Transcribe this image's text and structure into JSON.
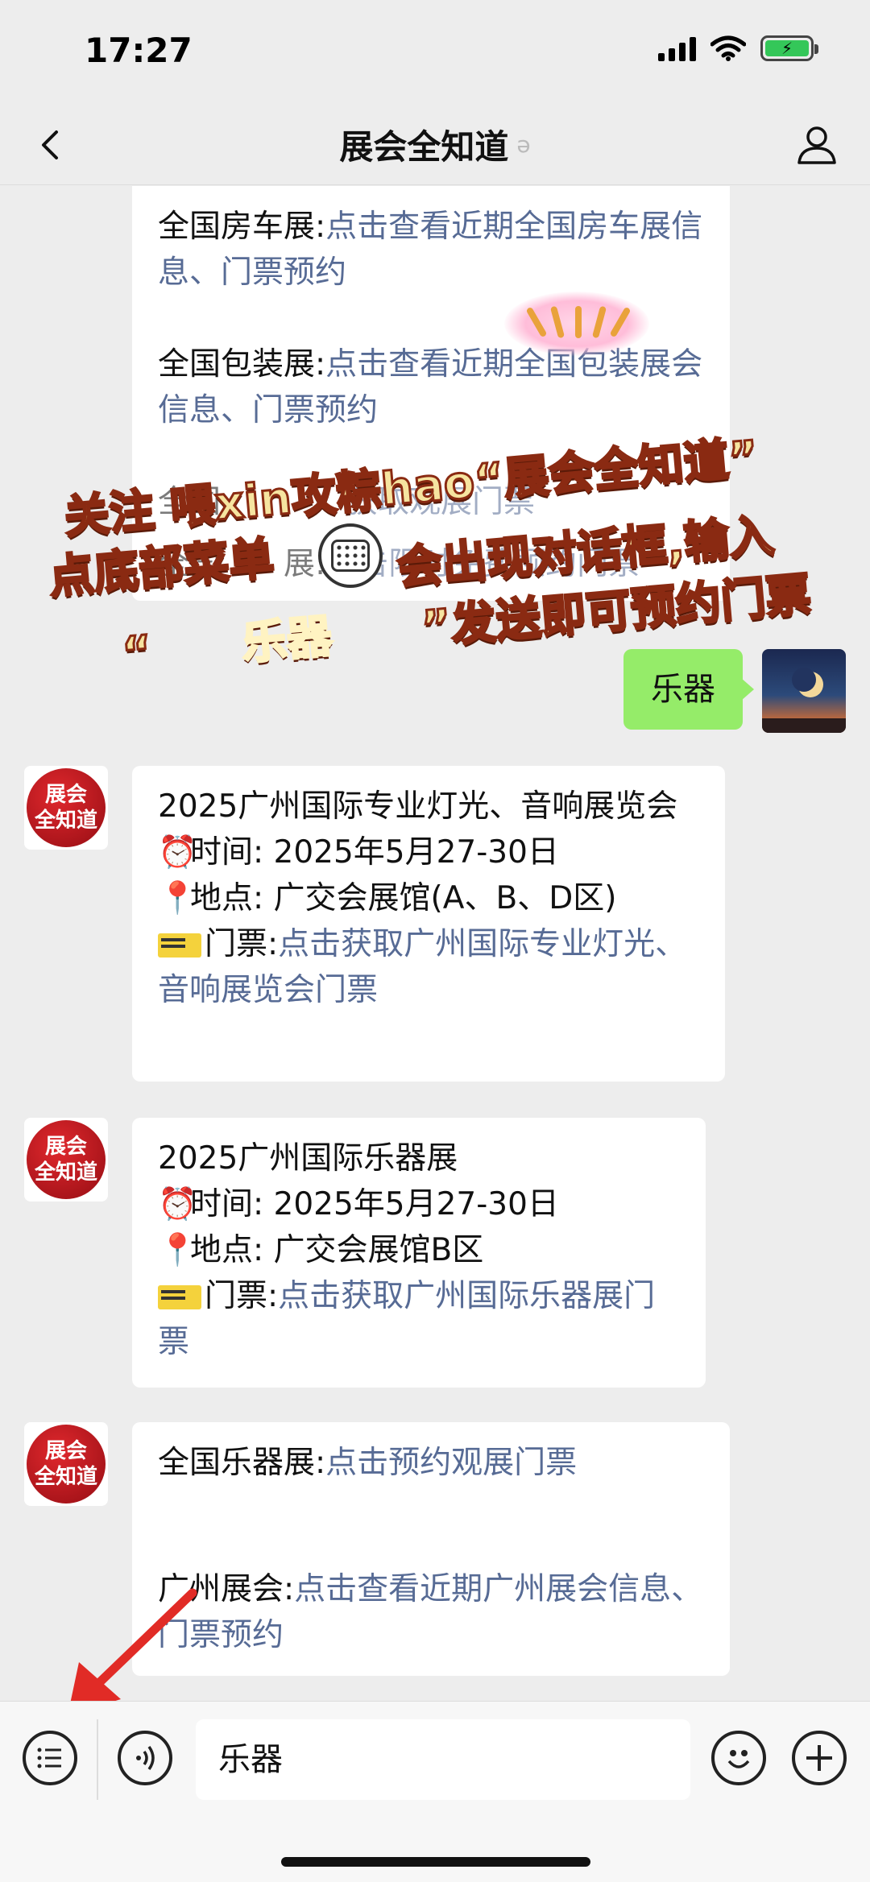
{
  "status_bar": {
    "time": "17:27"
  },
  "nav": {
    "title": "展会全知道",
    "ear": "𝄐"
  },
  "top_bubble": {
    "line1_label": "全国房车展:",
    "line1_link": "点击查看近期全国房车展信息、门票预约",
    "line2_label": "全国包装展:",
    "line2_link": "点击查看近期全国包装展会信息、门票预约",
    "line3_label": "全国",
    "line3_link": "获取观展门票",
    "line4_label": "全国",
    "line4_suffix": "展:",
    "line4_link": "点击限时免费预约门票"
  },
  "outgoing": {
    "text": "乐器"
  },
  "avatar_label": [
    "展会",
    "全知道"
  ],
  "msg1": {
    "title": "2025广州国际专业灯光、音响展览会",
    "time_label": "时间:",
    "time_value": "2025年5月27-30日",
    "place_label": "地点:",
    "place_value": "广交会展馆(A、B、D区)",
    "ticket_label": "门票:",
    "ticket_link": "点击获取广州国际专业灯光、音响展览会门票"
  },
  "msg2": {
    "title": "2025广州国际乐器展",
    "time_label": "时间:",
    "time_value": "2025年5月27-30日",
    "place_label": "地点:",
    "place_value": "广交会展馆B区",
    "ticket_label": "门票:",
    "ticket_link": "点击获取广州国际乐器展门票"
  },
  "msg3": {
    "line1_label": "全国乐器展:",
    "line1_link": "点击预约观展门票",
    "line2_label": "广州展会:",
    "line2_link": "点击查看近期广州展会信息、门票预约"
  },
  "promo": {
    "line1": "关注 喂xin攻粽hao“展会全知道”",
    "line2_a": "点底部菜单",
    "line2_b": "会出现对话框,输入",
    "line3_open": "“",
    "line3_word": "乐器",
    "line3_close": "”发送即可预约门票"
  },
  "input_bar": {
    "value": "乐器"
  },
  "colors": {
    "link": "#576b95",
    "outgoing_bubble": "#95ec69",
    "background": "#ededed"
  }
}
